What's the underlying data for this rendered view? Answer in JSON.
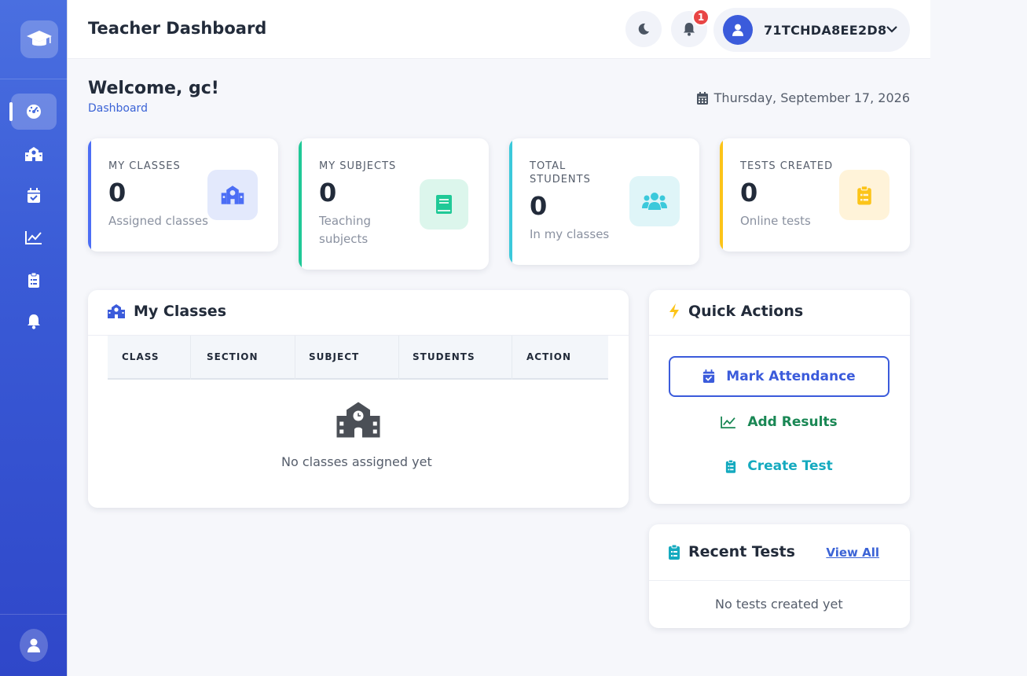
{
  "header": {
    "title": "Teacher Dashboard",
    "notification_count": "1",
    "user_name": "71TCHDA8EE2D8"
  },
  "welcome": {
    "greeting": "Welcome, gc!",
    "breadcrumb": "Dashboard",
    "date": "Thursday, September 17, 2026"
  },
  "stats": [
    {
      "label": "MY CLASSES",
      "value": "0",
      "sub": "Assigned classes",
      "accent": "#4c6ef5",
      "icon": "school-icon"
    },
    {
      "label": "MY SUBJECTS",
      "value": "0",
      "sub": "Teaching subjects",
      "accent": "#20c997",
      "icon": "book-icon"
    },
    {
      "label": "TOTAL STUDENTS",
      "value": "0",
      "sub": "In my classes",
      "accent": "#3bc9db",
      "icon": "users-icon"
    },
    {
      "label": "TESTS CREATED",
      "value": "0",
      "sub": "Online tests",
      "accent": "#fcc419",
      "icon": "clipboard-icon"
    }
  ],
  "my_classes": {
    "title": "My Classes",
    "columns": [
      "CLASS",
      "SECTION",
      "SUBJECT",
      "STUDENTS",
      "ACTION"
    ],
    "empty_text": "No classes assigned yet"
  },
  "quick_actions": {
    "title": "Quick Actions",
    "items": [
      {
        "label": "Mark Attendance",
        "color": "#3b5bdb"
      },
      {
        "label": "Add Results",
        "color": "#198754"
      },
      {
        "label": "Create Test",
        "color": "#15aabf"
      }
    ]
  },
  "recent_tests": {
    "title": "Recent Tests",
    "view_all": "View All",
    "empty_text": "No tests created yet"
  },
  "sidebar": {
    "items": [
      {
        "icon": "dashboard-icon",
        "active": true
      },
      {
        "icon": "school-icon"
      },
      {
        "icon": "calendar-check-icon"
      },
      {
        "icon": "chart-line-icon"
      },
      {
        "icon": "clipboard-list-icon"
      },
      {
        "icon": "bell-icon"
      }
    ]
  }
}
